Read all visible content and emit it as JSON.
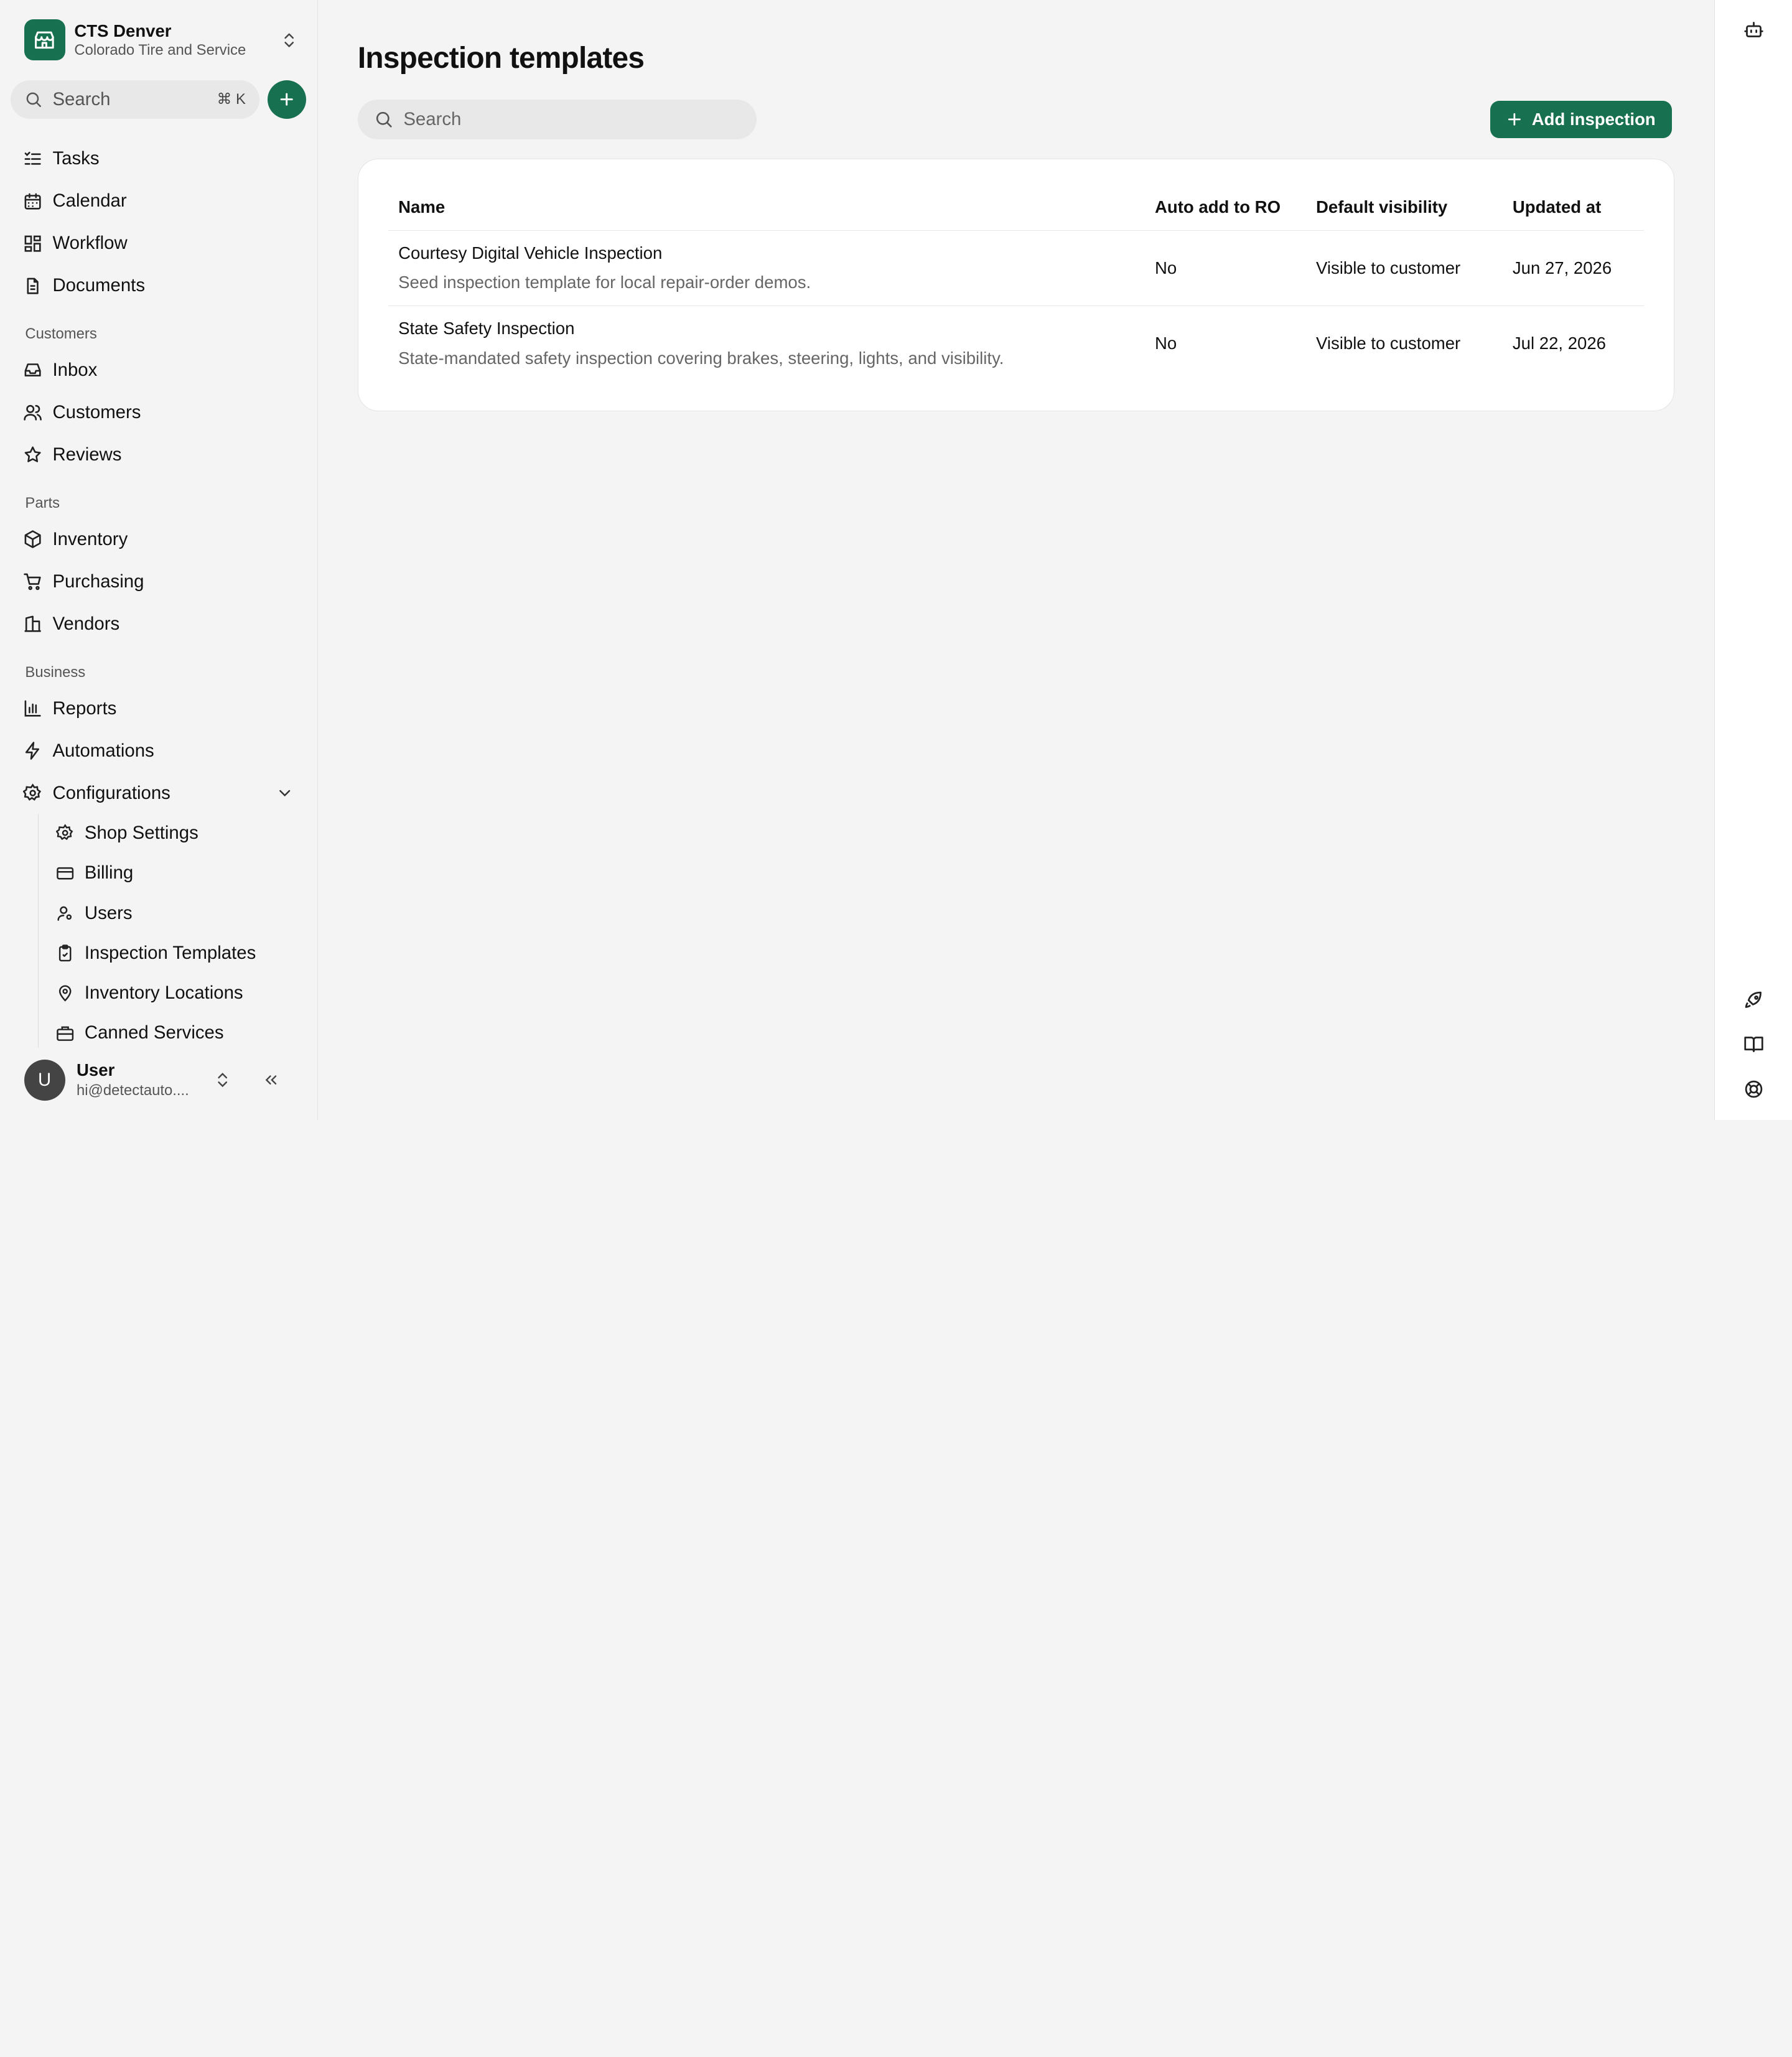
{
  "org": {
    "name": "CTS Denver",
    "subtitle": "Colorado Tire and Service"
  },
  "sidebar": {
    "search_placeholder": "Search",
    "search_shortcut": "⌘ K",
    "main_items": [
      {
        "label": "Tasks",
        "icon": "tasks-icon"
      },
      {
        "label": "Calendar",
        "icon": "calendar-icon"
      },
      {
        "label": "Workflow",
        "icon": "workflow-icon"
      },
      {
        "label": "Documents",
        "icon": "document-icon"
      }
    ],
    "customers_section": "Customers",
    "customers_items": [
      {
        "label": "Inbox",
        "icon": "inbox-icon"
      },
      {
        "label": "Customers",
        "icon": "users-icon"
      },
      {
        "label": "Reviews",
        "icon": "star-icon"
      }
    ],
    "parts_section": "Parts",
    "parts_items": [
      {
        "label": "Inventory",
        "icon": "package-icon"
      },
      {
        "label": "Purchasing",
        "icon": "cart-icon"
      },
      {
        "label": "Vendors",
        "icon": "building-icon"
      }
    ],
    "business_section": "Business",
    "business_items": [
      {
        "label": "Reports",
        "icon": "bar-chart-icon"
      },
      {
        "label": "Automations",
        "icon": "lightning-icon"
      },
      {
        "label": "Configurations",
        "icon": "gear-icon"
      }
    ],
    "config_items": [
      {
        "label": "Shop Settings",
        "icon": "gear-icon"
      },
      {
        "label": "Billing",
        "icon": "credit-card-icon"
      },
      {
        "label": "Users",
        "icon": "user-settings-icon"
      },
      {
        "label": "Inspection Templates",
        "icon": "clipboard-check-icon"
      },
      {
        "label": "Inventory Locations",
        "icon": "map-pin-icon"
      },
      {
        "label": "Canned Services",
        "icon": "briefcase-icon"
      }
    ]
  },
  "user": {
    "initial": "U",
    "name": "User",
    "email": "hi@detectauto...."
  },
  "main": {
    "title": "Inspection templates",
    "search_placeholder": "Search",
    "add_button": "Add inspection",
    "columns": [
      "Name",
      "Auto add to RO",
      "Default visibility",
      "Updated at"
    ],
    "rows": [
      {
        "name": "Courtesy Digital Vehicle Inspection",
        "description": "Seed inspection template for local repair-order demos.",
        "auto_add": "No",
        "visibility": "Visible to customer",
        "updated": "Jun 27, 2026"
      },
      {
        "name": "State Safety Inspection",
        "description": "State-mandated safety inspection covering brakes, steering, lights, and visibility.",
        "auto_add": "No",
        "visibility": "Visible to customer",
        "updated": "Jul 22, 2026"
      }
    ]
  },
  "colors": {
    "accent": "#17704f",
    "background": "#f4f4f4",
    "card": "#ffffff"
  }
}
